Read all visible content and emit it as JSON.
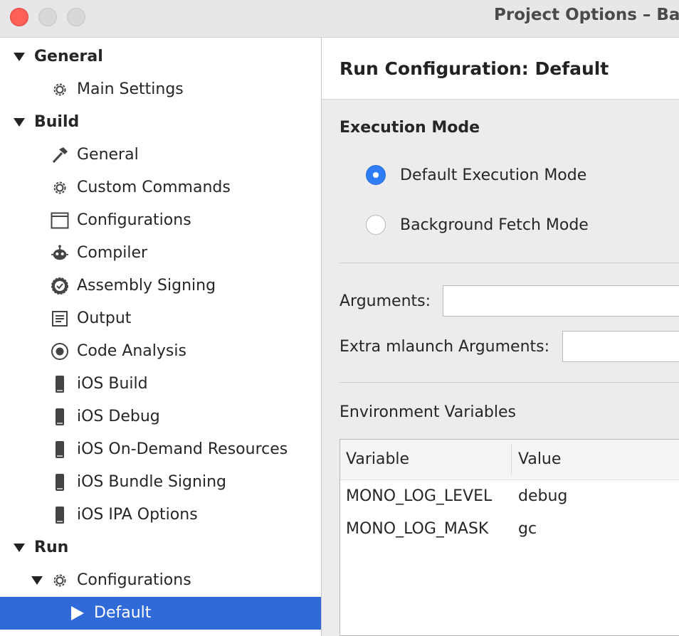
{
  "window": {
    "title": "Project Options – Ba"
  },
  "sidebar": {
    "items": [
      {
        "label": "General",
        "type": "category",
        "expanded": true,
        "icon": "triangle-down-icon"
      },
      {
        "label": "Main Settings",
        "type": "item",
        "icon": "gear-icon"
      },
      {
        "label": "Build",
        "type": "category",
        "expanded": true,
        "icon": "triangle-down-icon"
      },
      {
        "label": "General",
        "type": "item",
        "icon": "hammer-icon"
      },
      {
        "label": "Custom Commands",
        "type": "item",
        "icon": "gear-icon"
      },
      {
        "label": "Configurations",
        "type": "item",
        "icon": "window-icon"
      },
      {
        "label": "Compiler",
        "type": "item",
        "icon": "robot-icon"
      },
      {
        "label": "Assembly Signing",
        "type": "item",
        "icon": "badge-icon"
      },
      {
        "label": "Output",
        "type": "item",
        "icon": "document-icon"
      },
      {
        "label": "Code Analysis",
        "type": "item",
        "icon": "target-icon"
      },
      {
        "label": "iOS Build",
        "type": "item",
        "icon": "phone-icon"
      },
      {
        "label": "iOS Debug",
        "type": "item",
        "icon": "phone-icon"
      },
      {
        "label": "iOS On-Demand Resources",
        "type": "item",
        "icon": "phone-icon"
      },
      {
        "label": "iOS Bundle Signing",
        "type": "item",
        "icon": "phone-icon"
      },
      {
        "label": "iOS IPA Options",
        "type": "item",
        "icon": "phone-icon"
      },
      {
        "label": "Run",
        "type": "category",
        "expanded": true,
        "icon": "triangle-down-icon"
      },
      {
        "label": "Configurations",
        "type": "subcategory",
        "expanded": true,
        "icon": "gear-icon"
      },
      {
        "label": "Default",
        "type": "selected",
        "icon": "play-icon"
      }
    ]
  },
  "main": {
    "title": "Run Configuration: Default",
    "execution_mode": {
      "title": "Execution Mode",
      "options": [
        {
          "label": "Default Execution Mode",
          "checked": true
        },
        {
          "label": "Background Fetch Mode",
          "checked": false
        }
      ]
    },
    "arguments": {
      "label": "Arguments:",
      "value": ""
    },
    "extra_mlaunch": {
      "label": "Extra mlaunch Arguments:",
      "value": ""
    },
    "env": {
      "title": "Environment Variables",
      "columns": [
        "Variable",
        "Value"
      ],
      "rows": [
        [
          "MONO_LOG_LEVEL",
          "debug"
        ],
        [
          "MONO_LOG_MASK",
          "gc"
        ]
      ]
    }
  },
  "colors": {
    "selection": "#2f6ad8",
    "radio_checked": "#2f7df6",
    "close_button": "#fe5f57"
  }
}
